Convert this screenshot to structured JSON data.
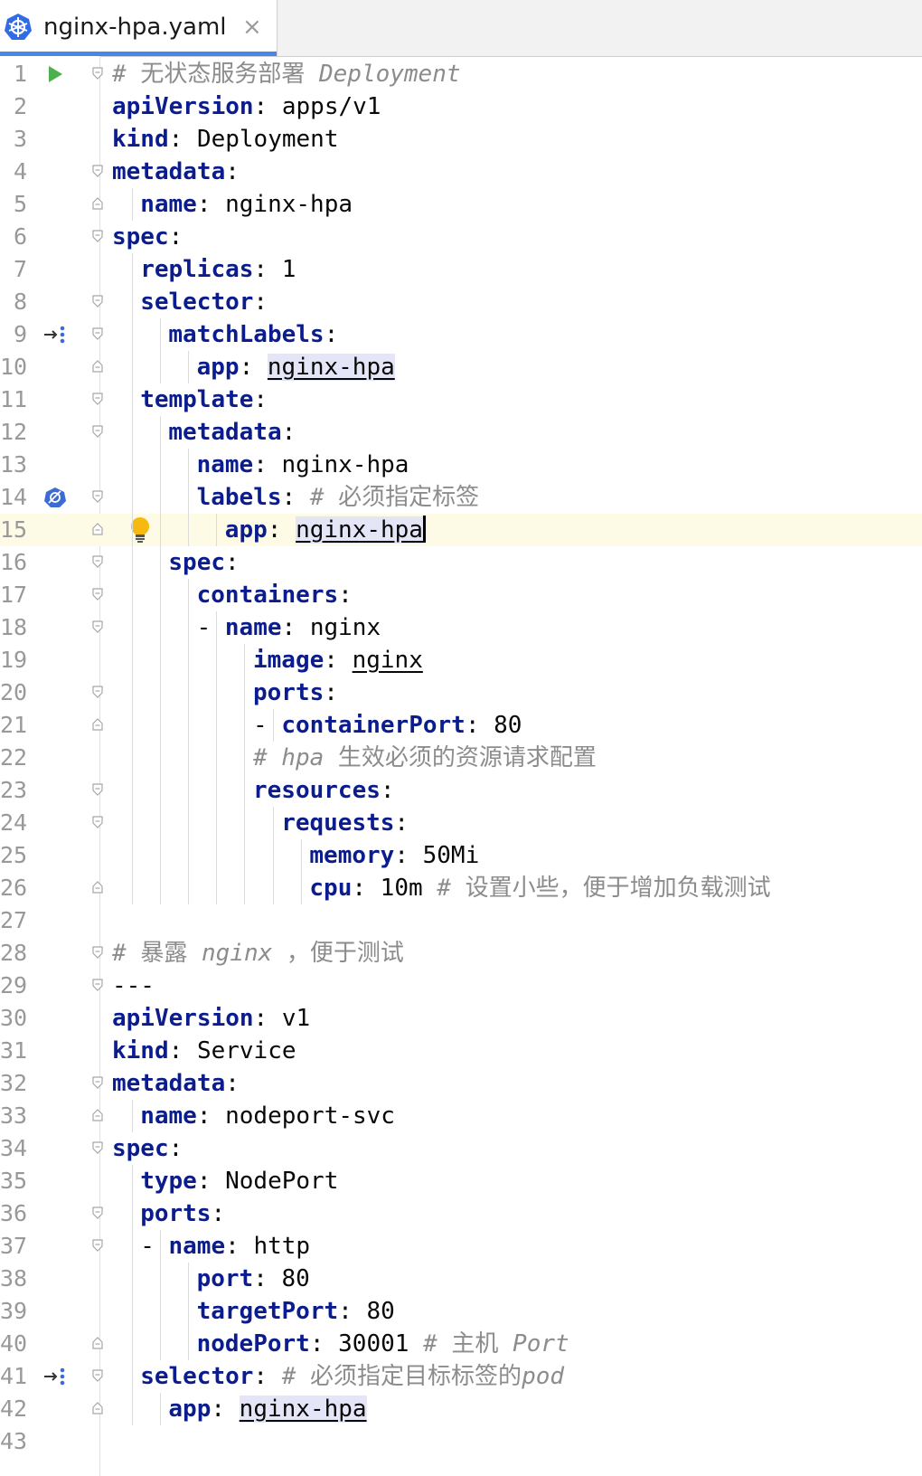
{
  "tab": {
    "title": "nginx-hpa.yaml",
    "close": "×",
    "icon": "kubernetes-icon"
  },
  "colors": {
    "keyword": "#0b1d8e",
    "comment": "#8c8c8c",
    "current_line": "#fdfbe6",
    "tab_underline": "#4a86e8",
    "run_icon": "#4caf50",
    "bulb": "#f5b90f"
  },
  "editor": {
    "current_line": 15,
    "lines": [
      {
        "n": "1",
        "indent": 0,
        "comment": "# 无状态服务部署 Deployment",
        "gutter": "run-icon",
        "fold": "open"
      },
      {
        "n": "2",
        "indent": 0,
        "key": "apiVersion",
        "value": "apps/v1"
      },
      {
        "n": "3",
        "indent": 0,
        "key": "kind",
        "value": "Deployment"
      },
      {
        "n": "4",
        "indent": 0,
        "key": "metadata",
        "fold": "open"
      },
      {
        "n": "5",
        "indent": 1,
        "key": "name",
        "value": "nginx-hpa",
        "fold": "close"
      },
      {
        "n": "6",
        "indent": 0,
        "key": "spec",
        "fold": "open"
      },
      {
        "n": "7",
        "indent": 1,
        "key": "replicas",
        "value": "1"
      },
      {
        "n": "8",
        "indent": 1,
        "key": "selector",
        "fold": "open"
      },
      {
        "n": "9",
        "indent": 2,
        "key": "matchLabels",
        "gutter": "arrow-icon",
        "fold": "open"
      },
      {
        "n": "10",
        "indent": 3,
        "key": "app",
        "value": "nginx-hpa",
        "value_style": "ref",
        "fold": "close"
      },
      {
        "n": "11",
        "indent": 1,
        "key": "template",
        "fold": "open"
      },
      {
        "n": "12",
        "indent": 2,
        "key": "metadata",
        "fold": "open"
      },
      {
        "n": "13",
        "indent": 3,
        "key": "name",
        "value": "nginx-hpa"
      },
      {
        "n": "14",
        "indent": 3,
        "key": "labels",
        "comment": "# 必须指定标签",
        "gutter": "kube-service-icon",
        "fold": "open"
      },
      {
        "n": "15",
        "indent": 4,
        "key": "app",
        "value": "nginx-hpa",
        "value_style": "ref",
        "caret": true,
        "bulb": true,
        "fold": "close"
      },
      {
        "n": "16",
        "indent": 2,
        "key": "spec",
        "fold": "open"
      },
      {
        "n": "17",
        "indent": 3,
        "key": "containers",
        "fold": "open"
      },
      {
        "n": "18",
        "indent": 4,
        "dash": true,
        "key": "name",
        "value": "nginx",
        "fold": "open"
      },
      {
        "n": "19",
        "indent": 5,
        "key": "image",
        "value": "nginx",
        "value_style": "ul"
      },
      {
        "n": "20",
        "indent": 5,
        "key": "ports",
        "fold": "open"
      },
      {
        "n": "21",
        "indent": 6,
        "dash": true,
        "key": "containerPort",
        "value": "80",
        "fold": "close"
      },
      {
        "n": "22",
        "indent": 5,
        "comment": "# hpa 生效必须的资源请求配置"
      },
      {
        "n": "23",
        "indent": 5,
        "key": "resources",
        "fold": "open"
      },
      {
        "n": "24",
        "indent": 6,
        "key": "requests",
        "fold": "open"
      },
      {
        "n": "25",
        "indent": 7,
        "key": "memory",
        "value": "50Mi"
      },
      {
        "n": "26",
        "indent": 7,
        "key": "cpu",
        "value": "10m",
        "comment": "# 设置小些，便于增加负载测试",
        "fold": "close"
      },
      {
        "n": "27",
        "indent": 0
      },
      {
        "n": "28",
        "indent": 0,
        "comment": "# 暴露 nginx ，便于测试",
        "fold": "open"
      },
      {
        "n": "29",
        "indent": 0,
        "plain": "---",
        "fold": "open"
      },
      {
        "n": "30",
        "indent": 0,
        "key": "apiVersion",
        "value": "v1"
      },
      {
        "n": "31",
        "indent": 0,
        "key": "kind",
        "value": "Service"
      },
      {
        "n": "32",
        "indent": 0,
        "key": "metadata",
        "fold": "open"
      },
      {
        "n": "33",
        "indent": 1,
        "key": "name",
        "value": "nodeport-svc",
        "fold": "close"
      },
      {
        "n": "34",
        "indent": 0,
        "key": "spec",
        "fold": "open"
      },
      {
        "n": "35",
        "indent": 1,
        "key": "type",
        "value": "NodePort"
      },
      {
        "n": "36",
        "indent": 1,
        "key": "ports",
        "fold": "open"
      },
      {
        "n": "37",
        "indent": 2,
        "dash": true,
        "key": "name",
        "value": "http",
        "fold": "open"
      },
      {
        "n": "38",
        "indent": 3,
        "key": "port",
        "value": "80"
      },
      {
        "n": "39",
        "indent": 3,
        "key": "targetPort",
        "value": "80"
      },
      {
        "n": "40",
        "indent": 3,
        "key": "nodePort",
        "value": "30001",
        "comment": "# 主机 Port",
        "fold": "close"
      },
      {
        "n": "41",
        "indent": 1,
        "key": "selector",
        "comment": "# 必须指定目标标签的pod",
        "gutter": "arrow-icon",
        "fold": "open"
      },
      {
        "n": "42",
        "indent": 2,
        "key": "app",
        "value": "nginx-hpa",
        "value_style": "ref",
        "fold": "close"
      },
      {
        "n": "43",
        "indent": 0
      }
    ]
  }
}
